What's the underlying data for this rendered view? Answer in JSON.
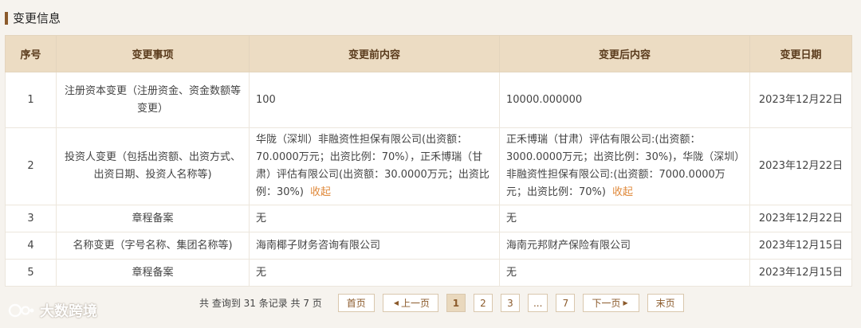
{
  "section": {
    "title": "变更信息"
  },
  "table": {
    "headers": [
      "序号",
      "变更事项",
      "变更前内容",
      "变更后内容",
      "变更日期"
    ],
    "rows": [
      {
        "index": "1",
        "item": "注册资本变更（注册资金、资金数额等变更）",
        "before": "100",
        "after": "10000.000000",
        "date": "2023年12月22日"
      },
      {
        "index": "2",
        "item": "投资人变更（包括出资额、出资方式、出资日期、投资人名称等)",
        "before": "华陇（深圳）非融资性担保有限公司(出资额：70.0000万元；出资比例：70%），正禾博瑞（甘肃）评估有限公司(出资额：30.0000万元；出资比例：30%)",
        "after": "正禾博瑞（甘肃）评估有限公司:(出资额：3000.0000万元；出资比例：30%)，华陇（深圳）非融资性担保有限公司:(出资额：7000.0000万元；出资比例：70%)",
        "date": "2023年12月22日"
      },
      {
        "index": "3",
        "item": "章程备案",
        "before": "无",
        "after": "无",
        "date": "2023年12月22日"
      },
      {
        "index": "4",
        "item": "名称变更（字号名称、集团名称等)",
        "before": "海南椰子财务咨询有限公司",
        "after": "海南元邦财产保险有限公司",
        "date": "2023年12月15日"
      },
      {
        "index": "5",
        "item": "章程备案",
        "before": "无",
        "after": "无",
        "date": "2023年12月15日"
      }
    ],
    "collapse_label": "收起"
  },
  "pagination": {
    "summary": "共 查询到 31 条记录 共 7 页",
    "first": "首页",
    "prev": "上一页",
    "pages": [
      "1",
      "2",
      "3",
      "...",
      "7"
    ],
    "current": "1",
    "next": "下一页",
    "last": "末页"
  },
  "watermark": {
    "text": "大数跨境"
  },
  "colors": {
    "header_bg": "#ecdcc3",
    "accent": "#8b5a2b",
    "link": "#e08a3c"
  }
}
